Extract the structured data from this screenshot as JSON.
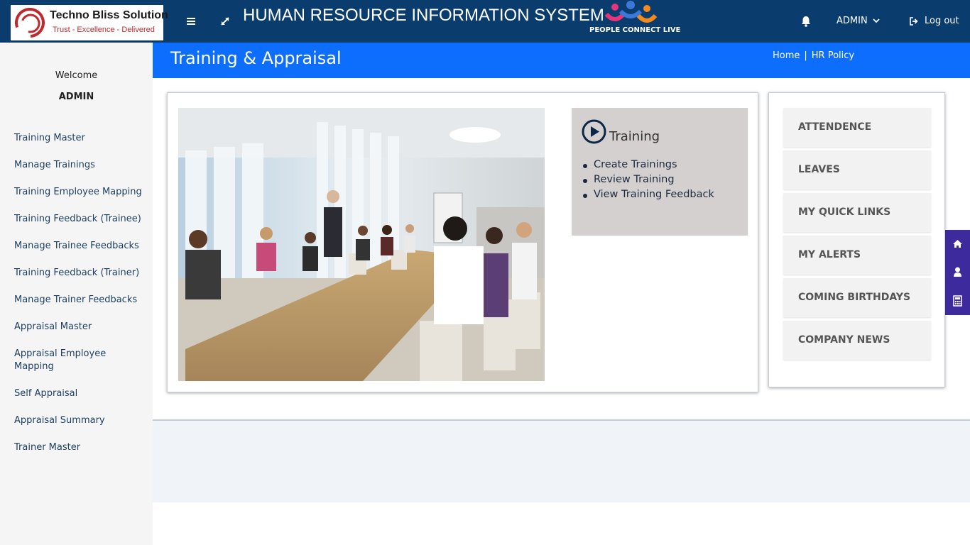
{
  "header": {
    "logo": {
      "title": "Techno Bliss Solution",
      "tagline": "Trust - Excellence - Delivered"
    },
    "app_title": "HUMAN RESOURCE INFORMATION SYSTEM",
    "brand_logo_text": "PEOPLE CONNECT LIVE",
    "user_menu_label": "ADMIN",
    "logout_label": "Log out",
    "icons": [
      "menu-icon",
      "expand-icon",
      "bell-icon",
      "chevron-down-icon",
      "logout-icon"
    ],
    "colors": {
      "topbar": "#0a3d6e",
      "accent": "#0d6efd"
    }
  },
  "sidebar": {
    "welcome": "Welcome",
    "username": "ADMIN",
    "items": [
      {
        "label": "Training Master"
      },
      {
        "label": "Manage Trainings"
      },
      {
        "label": "Training Employee Mapping"
      },
      {
        "label": "Training Feedback (Trainee)"
      },
      {
        "label": "Manage Trainee Feedbacks"
      },
      {
        "label": "Training Feedback (Trainer)"
      },
      {
        "label": "Manage Trainer Feedbacks"
      },
      {
        "label": "Appraisal Master"
      },
      {
        "label": "Appraisal Employee Mapping"
      },
      {
        "label": "Self Appraisal"
      },
      {
        "label": "Appraisal Summary"
      },
      {
        "label": "Trainer Master"
      }
    ]
  },
  "page": {
    "title": "Training & Appraisal",
    "breadcrumb": {
      "home": "Home",
      "separator": "|",
      "current": "HR Policy"
    }
  },
  "training_panel": {
    "heading": "Training",
    "icon": "play-circle-icon",
    "links": [
      {
        "label": "Create Trainings"
      },
      {
        "label": "Review Training"
      },
      {
        "label": "View Training Feedback"
      }
    ]
  },
  "quick_panel": {
    "buttons": [
      {
        "label": "ATTENDENCE"
      },
      {
        "label": "LEAVES"
      },
      {
        "label": "MY QUICK LINKS"
      },
      {
        "label": "MY ALERTS"
      },
      {
        "label": "COMING BIRTHDAYS"
      },
      {
        "label": "COMPANY NEWS"
      }
    ]
  },
  "floating_toolbar": {
    "icons": [
      "home-icon",
      "user-icon",
      "calculator-icon"
    ],
    "color": "#3d2a9c"
  }
}
